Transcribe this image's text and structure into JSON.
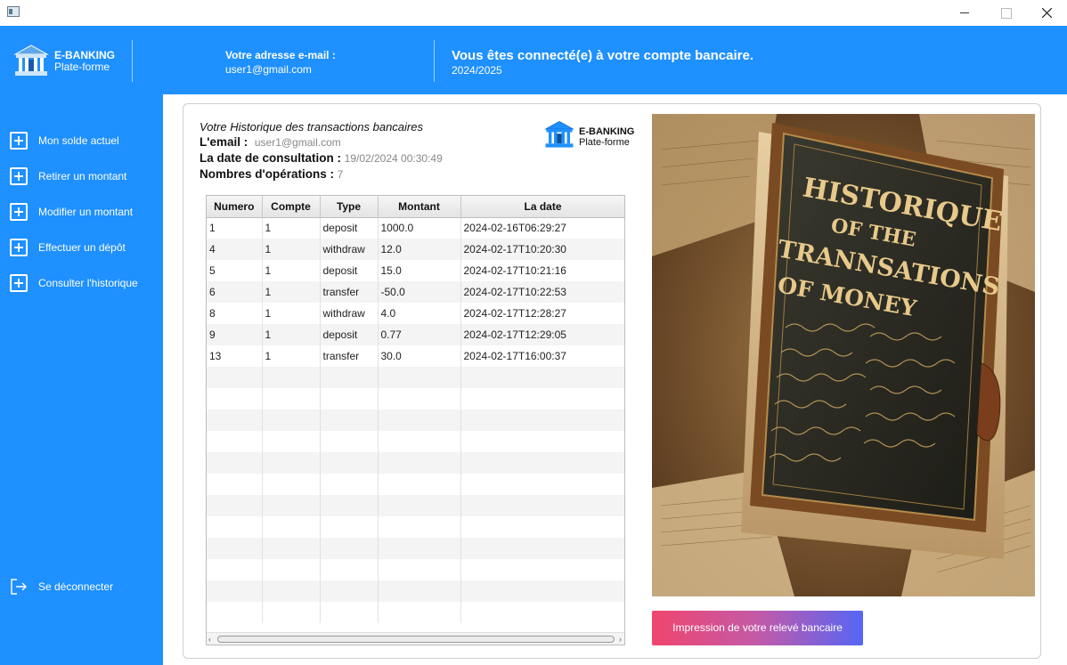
{
  "window": {
    "app_icon": "window-app-icon",
    "controls": [
      "minimize-icon",
      "maximize-icon",
      "close-icon"
    ]
  },
  "header": {
    "brand_name": "E-BANKING",
    "brand_sub": "Plate-forme",
    "email_label": "Votre adresse e-mail :",
    "email_value": "user1@gmail.com",
    "connected_title": "Vous êtes connecté(e) à votre compte bancaire.",
    "year": "2024/2025",
    "bank_icon": "bank-building-icon"
  },
  "sidebar": {
    "items": [
      {
        "label": "Mon solde actuel",
        "icon": "plus-square-icon"
      },
      {
        "label": "Retirer un montant",
        "icon": "plus-square-icon"
      },
      {
        "label": "Modifier un montant",
        "icon": "plus-square-icon"
      },
      {
        "label": "Effectuer un dépôt",
        "icon": "plus-square-icon"
      },
      {
        "label": "Consulter l'historique",
        "icon": "plus-square-icon"
      }
    ],
    "logout_label": "Se déconnecter",
    "logout_icon": "logout-icon"
  },
  "main": {
    "title": "Votre Historique des transactions bancaires",
    "email_key": "L'email :",
    "email_value": "user1@gmail.com",
    "date_key": "La date de consultation :",
    "date_value": "19/02/2024 00:30:49",
    "ops_key": "Nombres d'opérations :",
    "ops_value": "7",
    "brand_name": "E-BANKING",
    "brand_sub": "Plate-forme",
    "table": {
      "columns": [
        "Numero",
        "Compte",
        "Type",
        "Montant",
        "La date"
      ],
      "rows": [
        [
          "1",
          "1",
          "deposit",
          "1000.0",
          "2024-02-16T06:29:27"
        ],
        [
          "4",
          "1",
          "withdraw",
          "12.0",
          "2024-02-17T10:20:30"
        ],
        [
          "5",
          "1",
          "deposit",
          "15.0",
          "2024-02-17T10:21:16"
        ],
        [
          "6",
          "1",
          "transfer",
          "-50.0",
          "2024-02-17T10:22:53"
        ],
        [
          "8",
          "1",
          "withdraw",
          "4.0",
          "2024-02-17T12:28:27"
        ],
        [
          "9",
          "1",
          "deposit",
          "0.77",
          "2024-02-17T12:29:05"
        ],
        [
          "13",
          "1",
          "transfer",
          "30.0",
          "2024-02-17T16:00:37"
        ]
      ]
    },
    "book_image": {
      "line1": "HISTORIQUE",
      "line2": "OF THE",
      "line3": "TRANNSATIONS",
      "line4": "OF MONEY"
    },
    "print_button": "Impression de votre relevé bancaire"
  },
  "colors": {
    "brand_blue": "#1e90ff",
    "button_gradient_start": "#f0456d",
    "button_gradient_end": "#5566f5"
  }
}
